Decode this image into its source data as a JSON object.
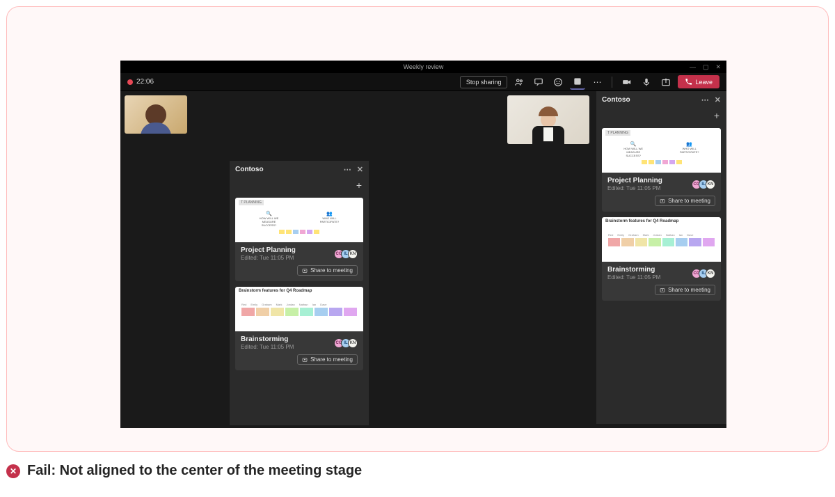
{
  "window": {
    "title": "Weekly review",
    "recording_time": "22:06",
    "stop_sharing": "Stop sharing",
    "leave": "Leave"
  },
  "panel": {
    "title": "Contoso",
    "cards": [
      {
        "preview_label": "T PLANNING",
        "nodes": [
          "HOW WILL WE MEASURE SUCCESS?",
          "WHO WILL PARTICIPATE?"
        ],
        "title": "Project Planning",
        "subtitle": "Edited: Tue 11:05 PM",
        "share": "Share to meeting"
      },
      {
        "preview_label": "Brainstorm features for Q4 Roadmap",
        "swatch_labels": [
          "Red",
          "Emily",
          "Graham",
          "Mark",
          "Jordan",
          "Nathan",
          "Ian",
          "Dave"
        ],
        "title": "Brainstorming",
        "subtitle": "Edited: Tue 11:05 PM",
        "share": "Share to meeting"
      }
    ]
  },
  "caption": "Fail: Not aligned to the center of the meeting stage"
}
